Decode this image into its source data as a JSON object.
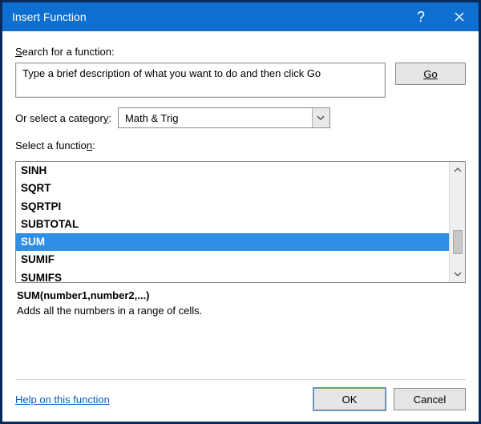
{
  "titlebar": {
    "title": "Insert Function"
  },
  "labels": {
    "search_for": "Search for a function:",
    "or_select_prefix": "Or select a categor",
    "or_select_accel": "y",
    "or_select_suffix": ":",
    "select_fn_prefix": "Select a functio",
    "select_fn_accel": "n",
    "select_fn_suffix": ":"
  },
  "search": {
    "value": "Type a brief description of what you want to do and then click Go"
  },
  "go": {
    "accel": "G",
    "rest": "o"
  },
  "category": {
    "selected": "Math & Trig"
  },
  "functions": [
    "SINH",
    "SQRT",
    "SQRTPI",
    "SUBTOTAL",
    "SUM",
    "SUMIF",
    "SUMIFS"
  ],
  "selected_index": 4,
  "description": {
    "signature": "SUM(number1,number2,...)",
    "text": "Adds all the numbers in a range of cells."
  },
  "footer": {
    "help_link": "Help on this function",
    "ok": "OK",
    "cancel": "Cancel"
  }
}
